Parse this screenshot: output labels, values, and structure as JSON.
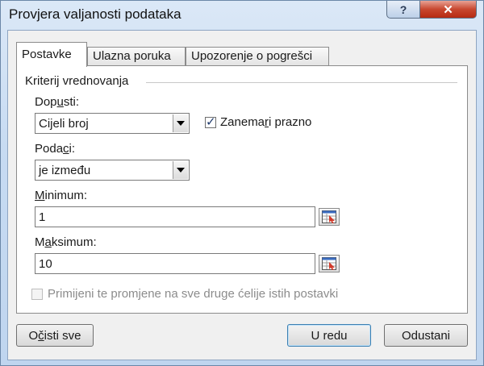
{
  "window": {
    "title": "Provjera valjanosti podataka",
    "help_label": "?",
    "close_label": "✕"
  },
  "tabs": [
    {
      "label": "Postavke",
      "active": true
    },
    {
      "label": "Ulazna poruka",
      "active": false
    },
    {
      "label": "Upozorenje o pogrešci",
      "active": false
    }
  ],
  "settings": {
    "group_label": "Kriterij vrednovanja",
    "allow": {
      "label_pre": "Dop",
      "label_u": "u",
      "label_post": "sti:",
      "value": "Cijeli broj"
    },
    "ignore_blank": {
      "label_pre": "Zanema",
      "label_u": "r",
      "label_post": "i prazno",
      "checked": true
    },
    "data": {
      "label_pre": "Poda",
      "label_u": "c",
      "label_post": "i:",
      "value": "je između"
    },
    "minimum": {
      "label_pre": "",
      "label_u": "M",
      "label_post": "inimum:",
      "value": "1"
    },
    "maximum": {
      "label_pre": "M",
      "label_u": "a",
      "label_post": "ksimum:",
      "value": "10"
    },
    "apply_all": {
      "label": "Primijeni te promjene na sve druge ćelije istih postavki",
      "checked": false,
      "enabled": false
    }
  },
  "buttons": {
    "clear_all": {
      "label_pre": "O",
      "label_u": "č",
      "label_post": "isti sve"
    },
    "ok": "U redu",
    "cancel": "Odustani"
  },
  "icons": {
    "dropdown": "chevron-down-icon",
    "range_picker": "range-select-icon",
    "check": "checkmark-icon"
  }
}
